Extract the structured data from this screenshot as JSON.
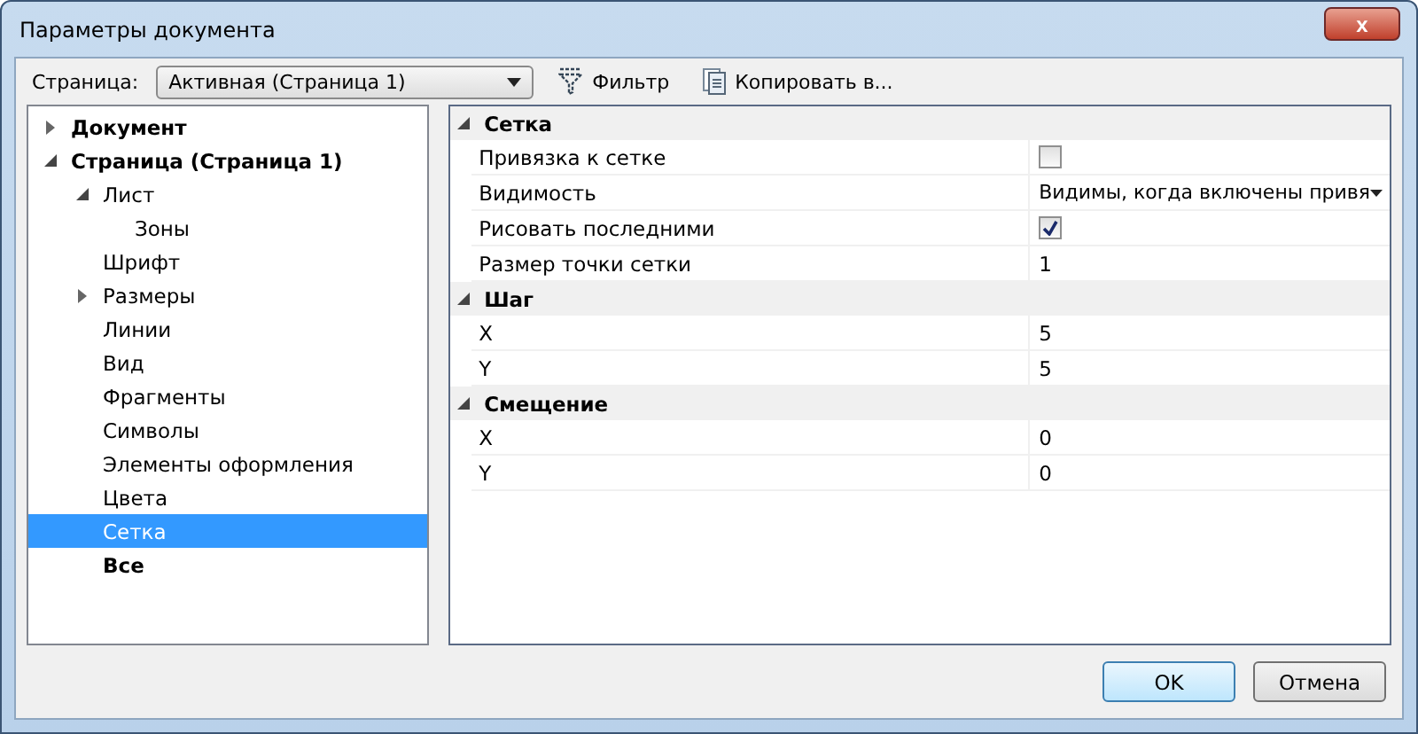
{
  "window": {
    "title": "Параметры документа",
    "close_label": "x"
  },
  "toolbar": {
    "page_label": "Страница:",
    "page_value": "Активная (Страница 1)",
    "filter": "Фильтр",
    "copy": "Копировать в..."
  },
  "tree": [
    {
      "label": "Документ",
      "kind": "group",
      "expanded": false,
      "selected": false
    },
    {
      "label": "Страница (Страница 1)",
      "kind": "group",
      "expanded": true,
      "selected": false,
      "children": [
        {
          "label": "Лист",
          "kind": "item",
          "expanded": true,
          "selected": false,
          "children": [
            {
              "label": "Зоны",
              "kind": "item",
              "selected": false
            }
          ]
        },
        {
          "label": "Шрифт",
          "kind": "item",
          "selected": false
        },
        {
          "label": "Размеры",
          "kind": "item",
          "expanded": false,
          "selected": false
        },
        {
          "label": "Линии",
          "kind": "item",
          "selected": false
        },
        {
          "label": "Вид",
          "kind": "item",
          "selected": false
        },
        {
          "label": "Фрагменты",
          "kind": "item",
          "selected": false
        },
        {
          "label": "Символы",
          "kind": "item",
          "selected": false
        },
        {
          "label": "Элементы оформления",
          "kind": "item",
          "selected": false
        },
        {
          "label": "Цвета",
          "kind": "item",
          "selected": false
        },
        {
          "label": "Сетка",
          "kind": "item",
          "selected": true
        },
        {
          "label": "Все",
          "kind": "group",
          "selected": false
        }
      ]
    }
  ],
  "properties": [
    {
      "category": "Сетка",
      "expanded": true,
      "rows": [
        {
          "name": "Привязка к сетке",
          "kind": "checkbox",
          "checked": false
        },
        {
          "name": "Видимость",
          "kind": "dropdown",
          "value": "Видимы, когда включены привя"
        },
        {
          "name": "Рисовать последними",
          "kind": "checkbox",
          "checked": true
        },
        {
          "name": "Размер точки сетки",
          "kind": "text",
          "value": "1"
        }
      ]
    },
    {
      "category": "Шаг",
      "expanded": true,
      "rows": [
        {
          "name": "X",
          "kind": "text",
          "value": "5"
        },
        {
          "name": "Y",
          "kind": "text",
          "value": "5"
        }
      ]
    },
    {
      "category": "Смещение",
      "expanded": true,
      "rows": [
        {
          "name": "X",
          "kind": "text",
          "value": "0"
        },
        {
          "name": "Y",
          "kind": "text",
          "value": "0"
        }
      ]
    }
  ],
  "buttons": [
    {
      "label": "OK",
      "default": true
    },
    {
      "label": "Отмена",
      "default": false
    }
  ]
}
